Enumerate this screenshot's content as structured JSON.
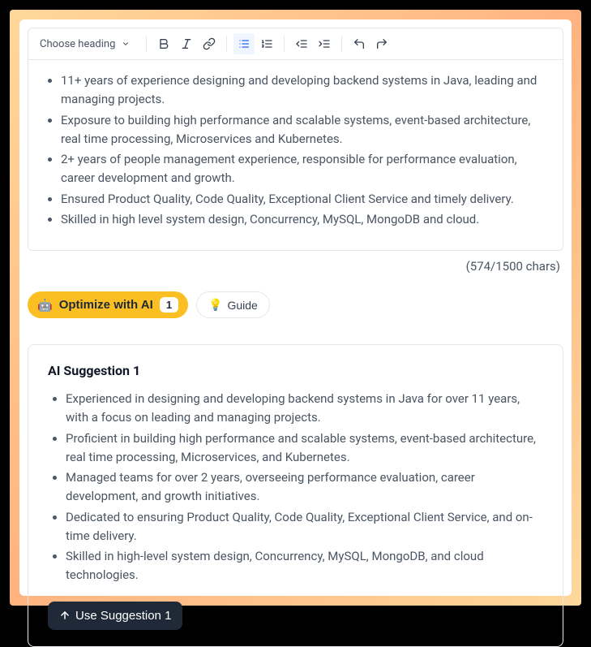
{
  "toolbar": {
    "heading_label": "Choose heading"
  },
  "editor": {
    "bullets": [
      "11+ years of experience designing and developing backend systems in Java, leading and managing projects.",
      "Exposure to building high performance and scalable systems, event-based architecture, real time processing, Microservices and Kubernetes.",
      "2+ years of people management experience, responsible for performance evaluation, career development and growth.",
      "Ensured Product Quality, Code Quality, Exceptional Client Service and timely delivery.",
      "Skilled in high level system design, Concurrency, MySQL, MongoDB and cloud."
    ],
    "char_count": "(574/1500 chars)"
  },
  "actions": {
    "optimize_label": "Optimize with AI",
    "optimize_badge": "1",
    "guide_label": "Guide"
  },
  "suggestion": {
    "title": "AI Suggestion 1",
    "bullets": [
      "Experienced in designing and developing backend systems in Java for over 11 years, with a focus on leading and managing projects.",
      "Proficient in building high performance and scalable systems, event-based architecture, real time processing, Microservices, and Kubernetes.",
      "Managed teams for over 2 years, overseeing performance evaluation, career development, and growth initiatives.",
      "Dedicated to ensuring Product Quality, Code Quality, Exceptional Client Service, and on-time delivery.",
      "Skilled in high-level system design, Concurrency, MySQL, MongoDB, and cloud technologies."
    ],
    "use_label": "Use Suggestion 1"
  }
}
